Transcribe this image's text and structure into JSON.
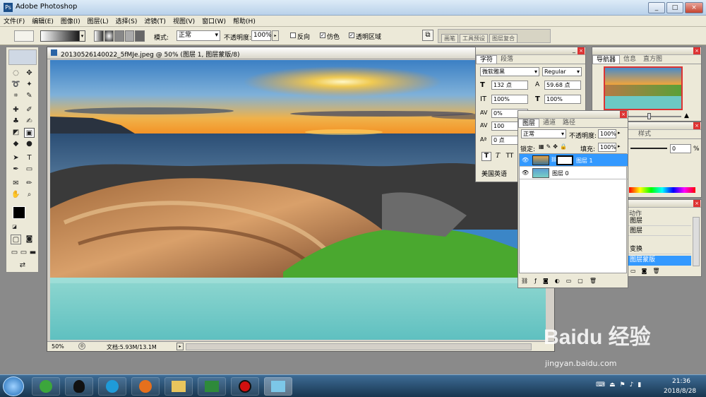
{
  "app": {
    "title": "Adobe Photoshop",
    "window_buttons": [
      "_",
      "□",
      "×"
    ]
  },
  "menu": [
    "文件(F)",
    "编辑(E)",
    "图像(I)",
    "图层(L)",
    "选择(S)",
    "滤镜(T)",
    "视图(V)",
    "窗口(W)",
    "帮助(H)"
  ],
  "options": {
    "mode_label": "模式:",
    "mode_value": "正常",
    "opacity_label": "不透明度:",
    "opacity_value": "100%",
    "reverse": "反向",
    "dither": "仿色",
    "transparency": "透明区域",
    "right_tabs": [
      "画笔",
      "工具预设",
      "图层复合"
    ]
  },
  "document": {
    "title": "20130526140022_5fMJe.jpeg @ 50% (图层 1, 图层蒙版/8)",
    "zoom": "50%",
    "doc_info": "文档:5.93M/13.1M"
  },
  "character_panel": {
    "tabs": [
      "字符",
      "段落"
    ],
    "font": "微软雅黑",
    "style": "Regular",
    "size": "132 点",
    "leading": "59.68 点",
    "vscale": "100%",
    "hscale": "100%",
    "tracking": "0%",
    "kerning": "100",
    "baseline": "0 点",
    "language": "美国英语",
    "format_buttons": [
      "T",
      "T",
      "TT"
    ]
  },
  "layers_panel": {
    "tabs": [
      "图层",
      "通道",
      "路径"
    ],
    "blend": "正常",
    "opacity_label": "不透明度:",
    "opacity": "100%",
    "lock_label": "锁定:",
    "fill_label": "填充:",
    "fill": "100%",
    "layers": [
      {
        "name": "图层 1",
        "selected": true
      },
      {
        "name": "图层 0",
        "selected": false
      }
    ]
  },
  "navigator_panel": {
    "tabs": [
      "导航器",
      "信息",
      "直方图"
    ]
  },
  "color_panel": {
    "tab": "样式",
    "value": "0",
    "unit": "%"
  },
  "history_panel": {
    "tab": "动作",
    "items": [
      "图层",
      "图层",
      "变换",
      "图层蒙版"
    ]
  },
  "watermark": {
    "brand": "Baidu 经验",
    "url": "jingyan.baidu.com"
  },
  "taskbar": {
    "time": "21:36",
    "date": "2018/8/28"
  },
  "colors": {
    "accent": "#3399ff",
    "taskbar": "#1f4460"
  }
}
